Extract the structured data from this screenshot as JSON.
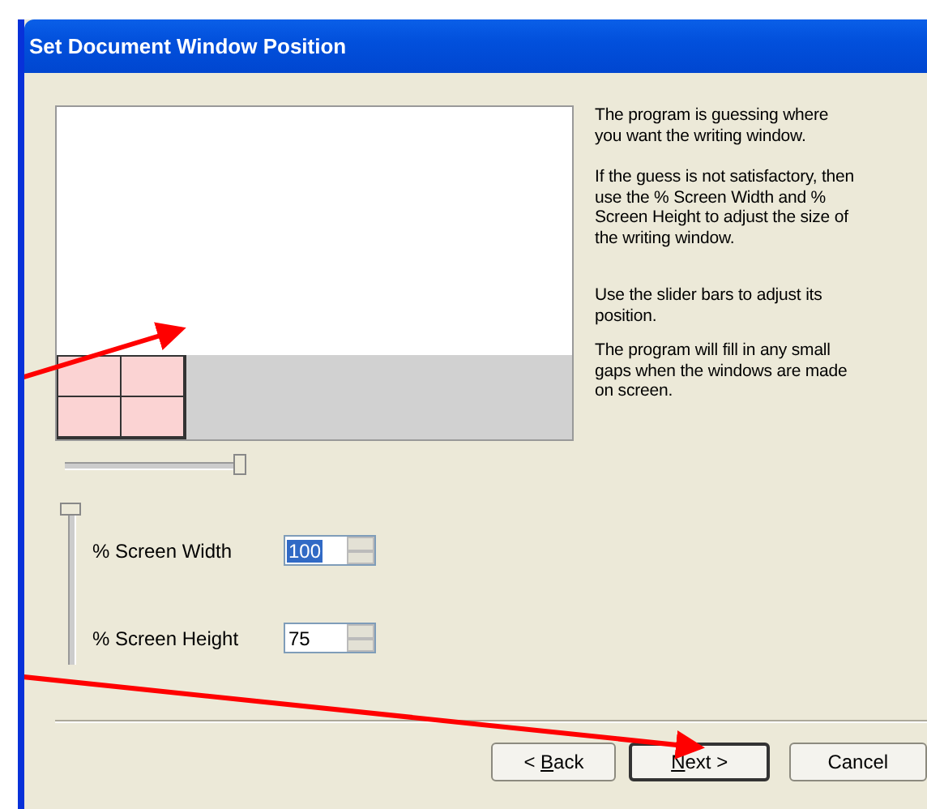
{
  "window": {
    "title": "Set Document Window Position"
  },
  "horizontal_slider": {
    "level": 1
  },
  "vertical_slider": {
    "level": 1
  },
  "help_paragraphs": [
    "The program is guessing where you want the writing window.",
    "If the guess is not satisfactory, then use the % Screen Width and % Screen Height to adjust the size of the writing window.",
    "Use the slider bars to adjust its position.",
    "The program will fill in any small gaps when the windows are made on screen."
  ],
  "fields": [
    {
      "label": "% Screen Width",
      "value": "100",
      "selected": true
    },
    {
      "label": "% Screen Height",
      "value": "75",
      "selected": false
    }
  ],
  "buttons": [
    {
      "before": "< ",
      "key": "B",
      "after": "ack",
      "default": false
    },
    {
      "key": "N",
      "after": "ext >",
      "default": true
    },
    {
      "before": "Cancel",
      "default": false
    }
  ]
}
